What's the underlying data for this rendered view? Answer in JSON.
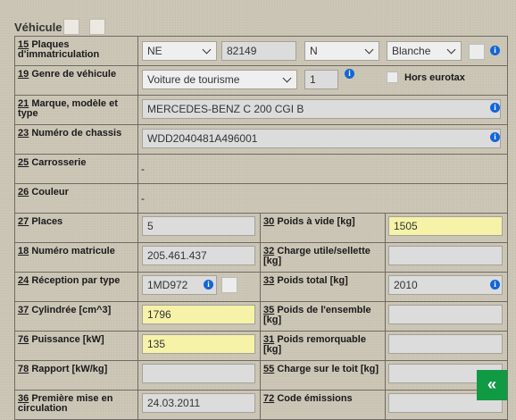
{
  "header": {
    "title": "Véhicule"
  },
  "rows": {
    "plates": {
      "num": "15",
      "label": "Plaques d'immatriculation",
      "canton": "NE",
      "number": "82149",
      "type": "N",
      "color": "Blanche"
    },
    "vehicle_type": {
      "num": "19",
      "label": "Genre de véhicule",
      "value": "Voiture de tourisme",
      "code": "1",
      "hors_label": "Hors eurotax"
    },
    "make": {
      "num": "21",
      "label": "Marque, modèle et type",
      "value": "MERCEDES-BENZ C 200 CGI B"
    },
    "chassis": {
      "num": "23",
      "label": "Numéro de chassis",
      "value": "WDD2040481A496001"
    },
    "body": {
      "num": "25",
      "label": "Carrosserie",
      "value": "-"
    },
    "color": {
      "num": "26",
      "label": "Couleur",
      "value": "-"
    },
    "places": {
      "num": "27",
      "label": "Places",
      "value": "5"
    },
    "empty_weight": {
      "num": "30",
      "label": "Poids à vide [kg]",
      "value": "1505"
    },
    "matricule": {
      "num": "18",
      "label": "Numéro matricule",
      "value": "205.461.437"
    },
    "payload": {
      "num": "32",
      "label": "Charge utile/sellette [kg]",
      "value": ""
    },
    "reception": {
      "num": "24",
      "label": "Réception par type",
      "value": "1MD972"
    },
    "total_weight": {
      "num": "33",
      "label": "Poids total [kg]",
      "value": "2010"
    },
    "displacement": {
      "num": "37",
      "label": "Cylindrée [cm^3]",
      "value": "1796"
    },
    "set_weight": {
      "num": "35",
      "label": "Poids de l'ensemble [kg]",
      "value": ""
    },
    "power": {
      "num": "76",
      "label": "Puissance [kW]",
      "value": "135"
    },
    "towable": {
      "num": "31",
      "label": "Poids remorquable [kg]",
      "value": ""
    },
    "ratio": {
      "num": "78",
      "label": "Rapport [kW/kg]",
      "value": ""
    },
    "roof_load": {
      "num": "55",
      "label": "Charge sur le toit [kg]",
      "value": ""
    },
    "first_reg": {
      "num": "36",
      "label": "Première mise en circulation",
      "value": "24.03.2011"
    },
    "emission": {
      "num": "72",
      "label": "Code émissions",
      "value": ""
    }
  },
  "buttons": {
    "back_label": "«"
  },
  "icons": {
    "info": "info-icon",
    "info_glyph": "i"
  },
  "colors": {
    "accent": "#119a44",
    "info": "#1466d6",
    "highlight": "#f6f3a8"
  }
}
